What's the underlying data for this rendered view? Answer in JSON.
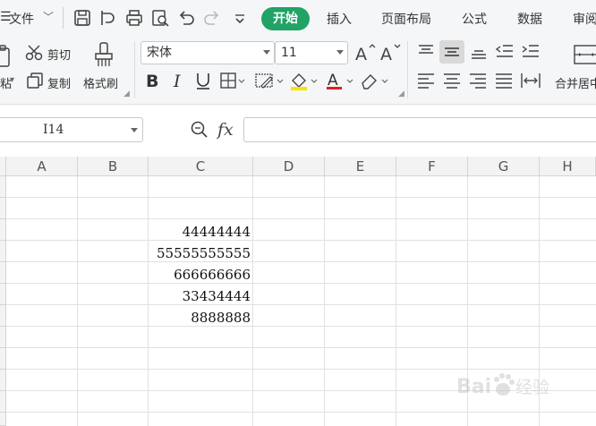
{
  "menu": {
    "file_label": "文件",
    "tabs": [
      "开始",
      "插入",
      "页面布局",
      "公式",
      "数据",
      "审阅"
    ]
  },
  "ribbon": {
    "cut_label": "剪切",
    "copy_label": "复制",
    "paste_label": "粘贴",
    "format_painter_label": "格式刷",
    "font_name": "宋体",
    "font_size": "11",
    "merge_label": "合并居中"
  },
  "formula_bar": {
    "name_box": "I14",
    "fx_label": "fx",
    "formula_value": ""
  },
  "grid": {
    "columns": [
      "A",
      "B",
      "C",
      "D",
      "E",
      "F",
      "G",
      "H"
    ],
    "cells_c": [
      "44444444",
      "55555555555",
      "666666666",
      "33434444",
      "8888888"
    ]
  },
  "colors": {
    "accent": "#21a366",
    "font_color_bar": "#e02020",
    "highlight_bar": "#f5e400"
  },
  "watermark_text": "Bai 经验"
}
